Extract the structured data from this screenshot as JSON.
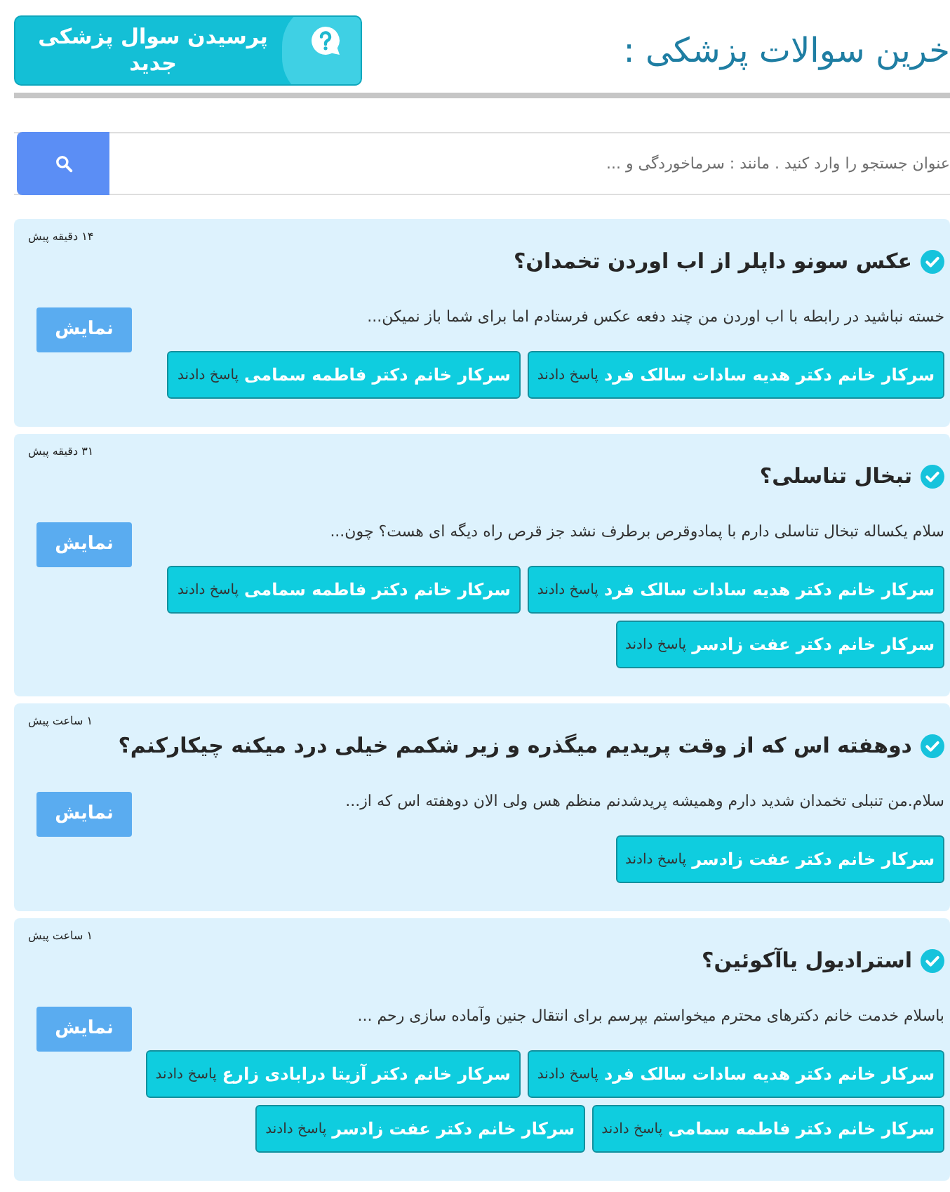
{
  "header": {
    "title": "خرین سوالات پزشکی :",
    "ask_button": "پرسیدن سوال پزشکی جدید"
  },
  "search": {
    "placeholder": "عنوان جستجو را وارد کنید . مانند : سرماخوردگی و ..."
  },
  "questions": [
    {
      "time": "۱۴ دقیقه پیش",
      "title": "عکس سونو داپلر از اب اوردن تخمدان؟",
      "excerpt": "خسته نباشید در رابطه با اب اوردن من چند دفعه عکس فرستادم اما برای شما باز نمیکن...",
      "show_button": "نمایش",
      "answers": [
        {
          "doctor": "سرکار خانم دکتر هدیه سادات سالک فرد",
          "verb": "پاسخ دادند"
        },
        {
          "doctor": "سرکار خانم دکتر فاطمه سمامی",
          "verb": "پاسخ دادند"
        }
      ]
    },
    {
      "time": "۳۱ دقیقه پیش",
      "title": "تبخال تناسلی؟",
      "excerpt": "سلام یکساله تبخال تناسلی دارم با پمادوقرص برطرف نشد جز قرص راه دیگه ای هست؟ چون...",
      "show_button": "نمایش",
      "answers": [
        {
          "doctor": "سرکار خانم دکتر هدیه سادات سالک فرد",
          "verb": "پاسخ دادند"
        },
        {
          "doctor": "سرکار خانم دکتر فاطمه سمامی",
          "verb": "پاسخ دادند"
        },
        {
          "doctor": "سرکار خانم دکتر عفت زادسر",
          "verb": "پاسخ دادند"
        }
      ]
    },
    {
      "time": "۱ ساعت پیش",
      "title": "دوهفته اس که از وقت پریدیم میگذره و زیر شکمم خیلی درد میکنه چیکارکنم؟",
      "excerpt": "سلام.من تنبلی تخمدان شدید دارم وهمیشه پریدشدنم منظم هس ولی الان دوهفته اس که از...",
      "show_button": "نمایش",
      "answers": [
        {
          "doctor": "سرکار خانم دکتر عفت زادسر",
          "verb": "پاسخ دادند"
        }
      ]
    },
    {
      "time": "۱ ساعت پیش",
      "title": "استرادیول یاآکوئین؟",
      "excerpt": "باسلام خدمت خانم دکترهای محترم میخواستم بپرسم برای انتقال جنین وآماده سازی رحم ...",
      "show_button": "نمایش",
      "answers": [
        {
          "doctor": "سرکار خانم دکتر هدیه سادات سالک فرد",
          "verb": "پاسخ دادند"
        },
        {
          "doctor": "سرکار خانم دکتر آزیتا درابادی زارع",
          "verb": "پاسخ دادند"
        },
        {
          "doctor": "سرکار خانم دکتر فاطمه سمامی",
          "verb": "پاسخ دادند"
        },
        {
          "doctor": "سرکار خانم دکتر عفت زادسر",
          "verb": "پاسخ دادند"
        }
      ]
    }
  ]
}
